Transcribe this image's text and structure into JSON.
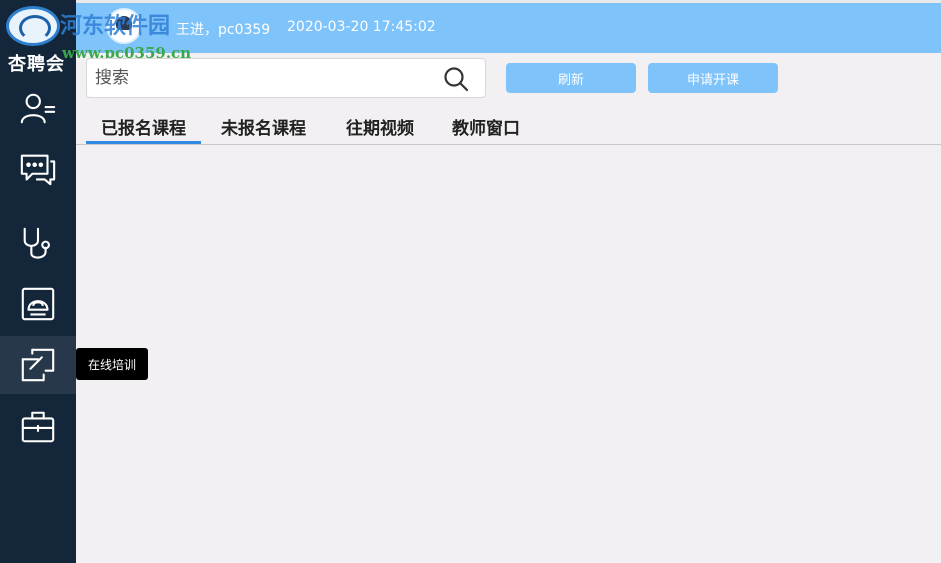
{
  "app": {
    "logo_text": "杏聘会",
    "watermark_title": "河东软件园",
    "watermark_url": "www.pc0359.cn"
  },
  "header": {
    "username": "王进，pc0359",
    "datetime": "2020-03-20 17:45:02",
    "background_color": "#7fc3fb"
  },
  "sidebar": {
    "background_color": "#14273a",
    "items": [
      {
        "icon": "user-list-icon",
        "label": "用户"
      },
      {
        "icon": "chat-icon",
        "label": "消息"
      },
      {
        "icon": "stethoscope-icon",
        "label": "问诊"
      },
      {
        "icon": "ultrasound-icon",
        "label": "超声"
      },
      {
        "icon": "online-training-icon",
        "label": "在线培训",
        "active": true
      },
      {
        "icon": "toolbox-icon",
        "label": "工具箱"
      }
    ]
  },
  "search": {
    "placeholder": "搜索",
    "value": ""
  },
  "toolbar": {
    "refresh_label": "刷新",
    "apply_label": "申请开课"
  },
  "tabs": [
    {
      "label": "已报名课程",
      "active": true
    },
    {
      "label": "未报名课程",
      "active": false
    },
    {
      "label": "往期视频",
      "active": false
    },
    {
      "label": "教师窗口",
      "active": false
    }
  ],
  "tooltip": {
    "text": "在线培训"
  },
  "colors": {
    "accent": "#2f8ae5",
    "button": "#7fc3fb",
    "content_bg": "#f2f0f3"
  }
}
